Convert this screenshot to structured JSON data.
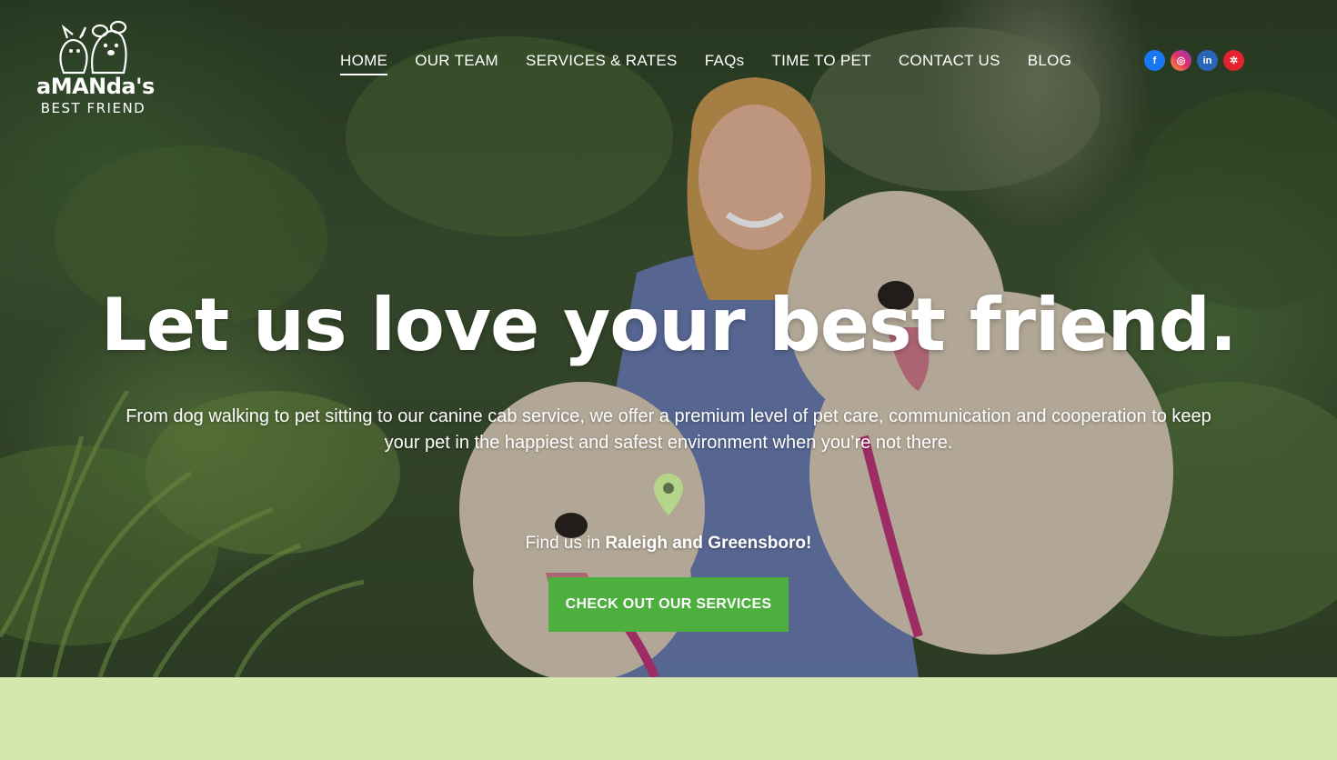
{
  "brand": {
    "name": "aMANda's",
    "tagline": "BEST FRIEND"
  },
  "nav": {
    "items": [
      {
        "label": "HOME",
        "active": true
      },
      {
        "label": "OUR TEAM"
      },
      {
        "label": "SERVICES & RATES"
      },
      {
        "label": "FAQs"
      },
      {
        "label": "TIME TO PET"
      },
      {
        "label": "CONTACT US"
      },
      {
        "label": "BLOG"
      }
    ]
  },
  "social": {
    "facebook": "f",
    "instagram": "◎",
    "linkedin": "in",
    "yelp": "✲"
  },
  "hero": {
    "headline": "Let us love your best friend.",
    "subtext": "From dog walking to pet sitting to our canine cab service, we offer a premium level of pet care, communication and cooperation to keep your pet in the happiest and safest environment when you’re not there.",
    "find_prefix": "Find us in",
    "find_locations": "Raleigh and Greensboro!",
    "cta_label": "CHECK OUT OUR SERVICES"
  },
  "colors": {
    "accent": "#4caf3e",
    "band": "#d3e7ae",
    "pin": "#b5d68a"
  }
}
